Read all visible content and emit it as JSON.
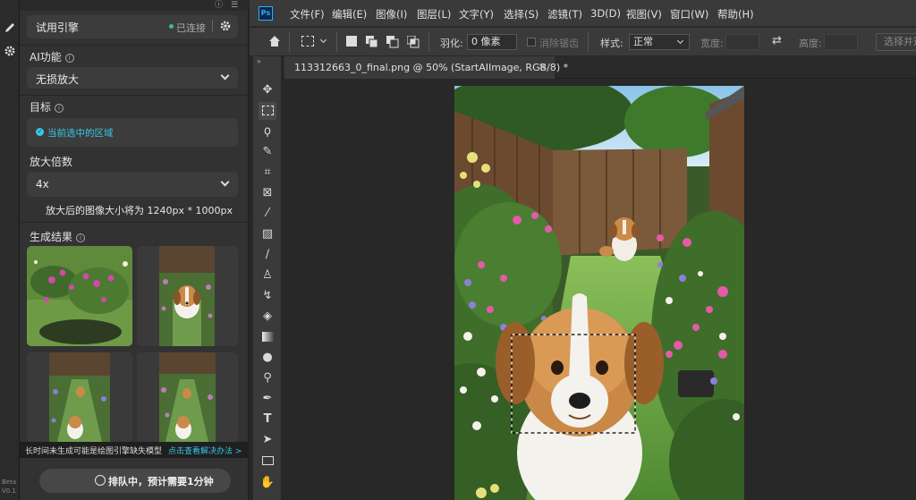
{
  "colors": {
    "accent": "#31a8ff",
    "ok": "#3cc37a",
    "cyan": "#34c8e8",
    "panel": "#323232"
  },
  "strip": {
    "beta_label": "Beta",
    "version": "V0.1",
    "icons": [
      "pen-icon",
      "gear-icon"
    ]
  },
  "plugin": {
    "engine": "试用引擎",
    "connected": "已连接",
    "ai_feature_label": "AI功能",
    "ai_feature_value": "无损放大",
    "target_label": "目标",
    "target_value": "当前选中的区域",
    "scale_label": "放大倍数",
    "scale_value": "4x",
    "scale_note": "放大后的图像大小将为 1240px * 1000px",
    "results_label": "生成结果",
    "warning": "长时间未生成可能是绘图引擎缺失模型",
    "warning_link": "点击查看解决办法 >",
    "queue_button": "排队中，预计需要1分钟"
  },
  "menubar": {
    "logo": "Ps",
    "items": [
      "文件(F)",
      "编辑(E)",
      "图像(I)",
      "图层(L)",
      "文字(Y)",
      "选择(S)",
      "滤镜(T)",
      "3D(D)",
      "视图(V)",
      "窗口(W)",
      "帮助(H)"
    ]
  },
  "options": {
    "feather_label": "羽化:",
    "feather_value": "0 像素",
    "antialias": "消除锯齿",
    "style_label": "样式:",
    "style_value": "正常",
    "width_label": "宽度:",
    "height_label": "高度:",
    "select_mask": "选择并遮"
  },
  "document": {
    "tab_title": "113312663_0_final.png @ 50% (StartAIImage, RGB/8) *"
  }
}
